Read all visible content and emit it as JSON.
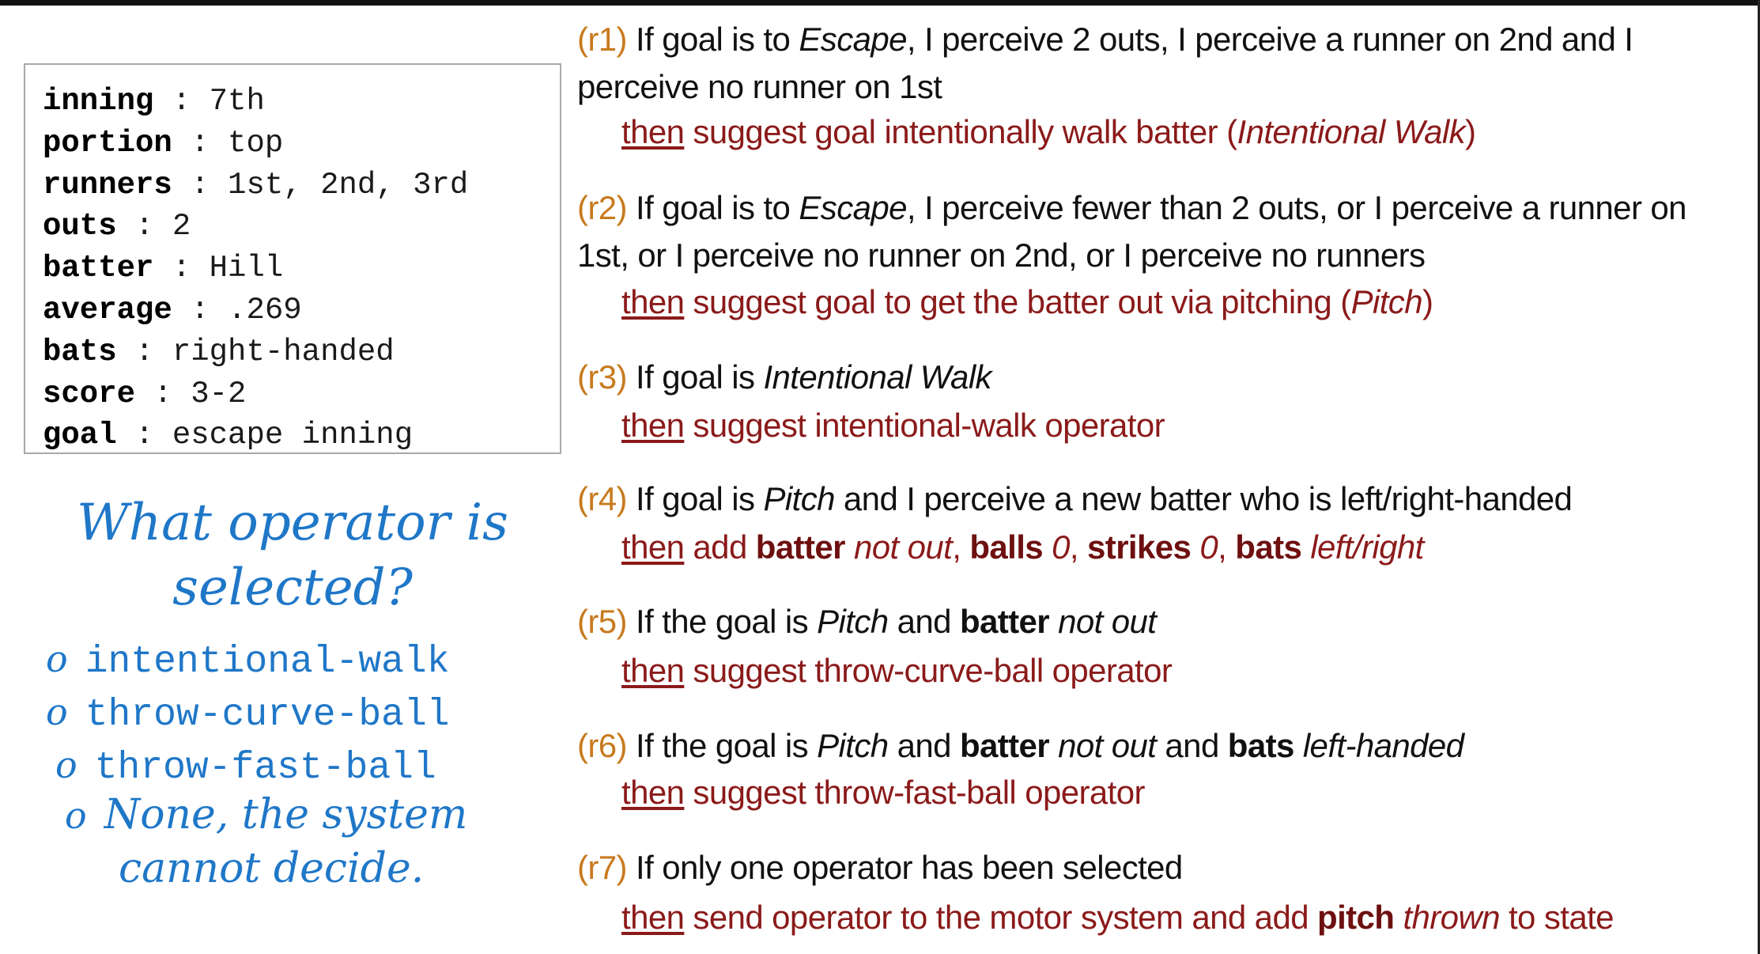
{
  "state": {
    "rows": [
      {
        "key": "inning",
        "value": "7th"
      },
      {
        "key": "portion",
        "value": "top"
      },
      {
        "key": "runners",
        "value": "1st, 2nd, 3rd"
      },
      {
        "key": "outs",
        "value": "2"
      },
      {
        "key": "batter",
        "value": "Hill"
      },
      {
        "key": "average",
        "value": ".269"
      },
      {
        "key": "bats",
        "value": "right-handed"
      },
      {
        "key": "score",
        "value": "3-2"
      },
      {
        "key": "goal",
        "value": "escape inning"
      }
    ]
  },
  "question": {
    "line1": "What operator is",
    "line2": "selected?",
    "bullet": "o",
    "options": [
      "intentional-walk",
      "throw-curve-ball",
      "throw-fast-ball"
    ],
    "none_line1": "None, the system",
    "none_line2": "cannot decide."
  },
  "rules": {
    "then_word": "then",
    "r1": {
      "id": "(r1)",
      "if_parts": [
        "If goal is to ",
        "Escape",
        ", I perceive 2 outs, I perceive a runner on 2nd and I perceive no runner on 1st"
      ],
      "then_parts": [
        " suggest goal intentionally walk batter (",
        "Intentional Walk",
        ")"
      ]
    },
    "r2": {
      "id": "(r2)",
      "if_parts": [
        "If goal is to ",
        "Escape",
        ", I perceive fewer than 2 outs, or I perceive a runner on 1st, or I perceive no runner on 2nd, or I perceive no runners"
      ],
      "then_parts": [
        " suggest goal to get the batter out via pitching (",
        "Pitch",
        ")"
      ]
    },
    "r3": {
      "id": "(r3)",
      "if_parts": [
        "If goal is ",
        "Intentional Walk"
      ],
      "then_parts": [
        " suggest intentional-walk operator"
      ]
    },
    "r4": {
      "id": "(r4)",
      "if_parts": [
        "If goal is ",
        "Pitch",
        " and I perceive a new batter who is left/right-handed"
      ],
      "then_parts": [
        " add ",
        "batter",
        " ",
        "not out",
        ", ",
        "balls",
        " ",
        "0",
        ", ",
        "strikes",
        " ",
        "0",
        ", ",
        "bats",
        " ",
        "left/right"
      ]
    },
    "r5": {
      "id": "(r5)",
      "if_parts": [
        "If the goal is ",
        "Pitch",
        " and ",
        "batter",
        " ",
        "not out"
      ],
      "then_parts": [
        " suggest throw-curve-ball operator"
      ]
    },
    "r6": {
      "id": "(r6)",
      "if_parts": [
        "If the goal is ",
        "Pitch",
        " and ",
        "batter",
        " ",
        "not out",
        " and ",
        "bats",
        " ",
        "left-handed"
      ],
      "then_parts": [
        " suggest throw-fast-ball operator"
      ]
    },
    "r7": {
      "id": "(r7)",
      "if_parts": [
        "If only one operator has been selected"
      ],
      "then_parts": [
        " send operator to the motor system and add ",
        "pitch",
        " ",
        "thrown",
        " to state"
      ]
    }
  }
}
